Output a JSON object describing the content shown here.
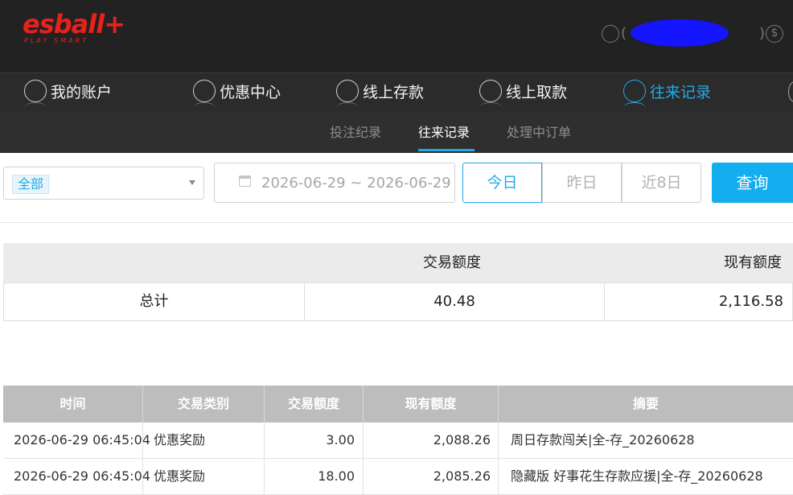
{
  "header": {
    "logo_text": "esball+",
    "logo_tagline": "PLAY SMART"
  },
  "main_nav": [
    {
      "label": "我的账户",
      "icon": "user-icon"
    },
    {
      "label": "优惠中心",
      "icon": "gift-icon"
    },
    {
      "label": "线上存款",
      "icon": "deposit-icon"
    },
    {
      "label": "线上取款",
      "icon": "withdraw-icon"
    },
    {
      "label": "往来记录",
      "icon": "records-icon",
      "active": true
    }
  ],
  "sub_nav": [
    {
      "label": "投注纪录"
    },
    {
      "label": "往来记录",
      "active": true
    },
    {
      "label": "处理中订单"
    }
  ],
  "filters": {
    "type_selected": "全部",
    "date_range": "2026-06-29 ~ 2026-06-29",
    "quick_ranges": [
      "今日",
      "昨日",
      "近8日"
    ],
    "active_range": "今日",
    "search_label": "查询"
  },
  "summary": {
    "headers": [
      "",
      "交易额度",
      "现有额度"
    ],
    "row_label": "总计",
    "transaction_amount": "40.48",
    "current_balance": "2,116.58"
  },
  "records": {
    "headers": [
      "时间",
      "交易类别",
      "交易额度",
      "现有额度",
      "摘要"
    ],
    "rows": [
      {
        "time": "2026-06-29 06:45:04",
        "type": "优惠奖励",
        "amount": "3.00",
        "balance": "2,088.26",
        "summary": "周日存款闯关|全-存_20260628"
      },
      {
        "time": "2026-06-29 06:45:04",
        "type": "优惠奖励",
        "amount": "18.00",
        "balance": "2,085.26",
        "summary": "隐藏版 好事花生存款应援|全-存_20260628"
      }
    ]
  },
  "colors": {
    "accent": "#23a9e6",
    "button": "#12aef0",
    "brand": "#e8211c",
    "header_bg": "#222222"
  }
}
